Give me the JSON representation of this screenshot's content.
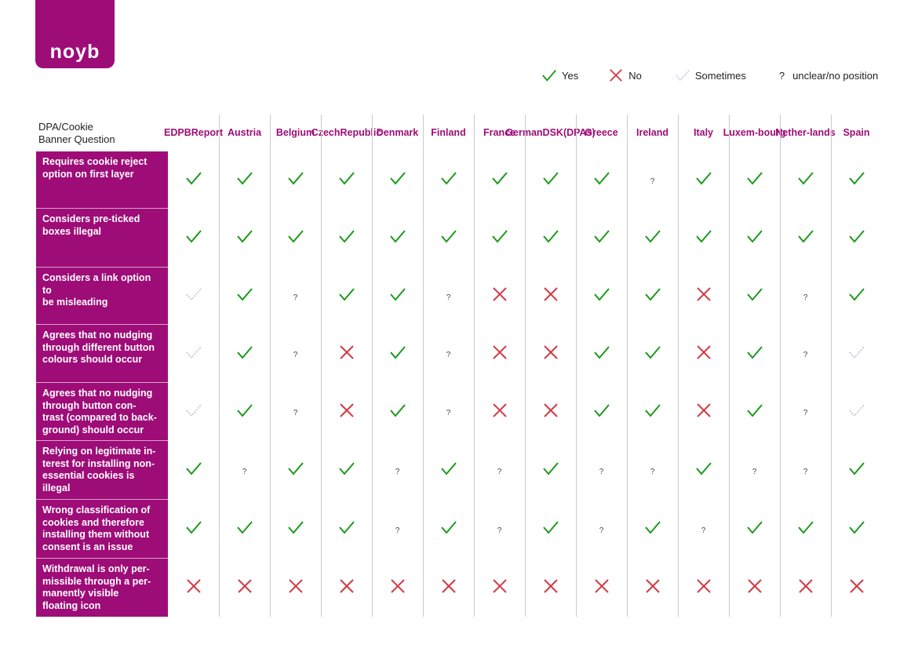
{
  "logo": {
    "text": "noyb"
  },
  "colors": {
    "brand": "#9e0c78",
    "yes": "#1a9a1a",
    "no": "#d23a46",
    "sometimes": "#b8b8cc"
  },
  "legend": [
    {
      "key": "yes",
      "icon": "check-icon",
      "label": "Yes"
    },
    {
      "key": "no",
      "icon": "cross-icon",
      "label": "No"
    },
    {
      "key": "sometimes",
      "icon": "dotted-check-icon",
      "label": "Sometimes"
    },
    {
      "key": "unclear",
      "icon": "question-icon",
      "label": "unclear/no position"
    }
  ],
  "table": {
    "question_header": [
      "DPA/Cookie",
      "Banner Question"
    ],
    "columns": [
      [
        "EDPB",
        "Report"
      ],
      [
        "Austria"
      ],
      [
        "Belgium"
      ],
      [
        "Czech",
        "Republic"
      ],
      [
        "Denmark"
      ],
      [
        "Finland"
      ],
      [
        "France"
      ],
      [
        "German",
        "DSK",
        "(DPAs)"
      ],
      [
        "Greece"
      ],
      [
        "Ireland"
      ],
      [
        "Italy"
      ],
      [
        "Luxem-",
        "bourg"
      ],
      [
        "Nether-",
        "lands"
      ],
      [
        "Spain"
      ]
    ],
    "rows": [
      {
        "question": [
          "Requires cookie reject",
          "option on first layer"
        ],
        "values": [
          "yes",
          "yes",
          "yes",
          "yes",
          "yes",
          "yes",
          "yes",
          "yes",
          "yes",
          "unclear",
          "yes",
          "yes",
          "yes",
          "yes"
        ]
      },
      {
        "question": [
          "Considers pre-ticked",
          "boxes illegal"
        ],
        "values": [
          "yes",
          "yes",
          "yes",
          "yes",
          "yes",
          "yes",
          "yes",
          "yes",
          "yes",
          "yes",
          "yes",
          "yes",
          "yes",
          "yes"
        ]
      },
      {
        "question": [
          "Considers a link option to",
          "be misleading"
        ],
        "values": [
          "sometimes",
          "yes",
          "unclear",
          "yes",
          "yes",
          "unclear",
          "no",
          "no",
          "yes",
          "yes",
          "no",
          "yes",
          "unclear",
          "yes"
        ]
      },
      {
        "question": [
          "Agrees that no nudging",
          "through different button",
          "colours should occur"
        ],
        "values": [
          "sometimes",
          "yes",
          "unclear",
          "no",
          "yes",
          "unclear",
          "no",
          "no",
          "yes",
          "yes",
          "no",
          "yes",
          "unclear",
          "sometimes"
        ]
      },
      {
        "question": [
          "Agrees that no nudging",
          "through button con-",
          "trast (compared to back-",
          "ground) should occur"
        ],
        "values": [
          "sometimes",
          "yes",
          "unclear",
          "no",
          "yes",
          "unclear",
          "no",
          "no",
          "yes",
          "yes",
          "no",
          "yes",
          "unclear",
          "sometimes"
        ]
      },
      {
        "question": [
          "Relying on legitimate in-",
          "terest for installing non-",
          "essential cookies is illegal"
        ],
        "values": [
          "yes",
          "unclear",
          "yes",
          "yes",
          "unclear",
          "yes",
          "unclear",
          "yes",
          "unclear",
          "unclear",
          "yes",
          "unclear",
          "unclear",
          "yes"
        ]
      },
      {
        "question": [
          "Wrong classification of",
          "cookies and therefore",
          "installing them without",
          "consent is an issue"
        ],
        "values": [
          "yes",
          "yes",
          "yes",
          "yes",
          "unclear",
          "yes",
          "unclear",
          "yes",
          "unclear",
          "yes",
          "unclear",
          "yes",
          "yes",
          "yes"
        ]
      },
      {
        "question": [
          "Withdrawal is only per-",
          "missible through a per-",
          "manently visible",
          "floating icon"
        ],
        "values": [
          "no",
          "no",
          "no",
          "no",
          "no",
          "no",
          "no",
          "no",
          "no",
          "no",
          "no",
          "no",
          "no",
          "no"
        ]
      }
    ]
  }
}
